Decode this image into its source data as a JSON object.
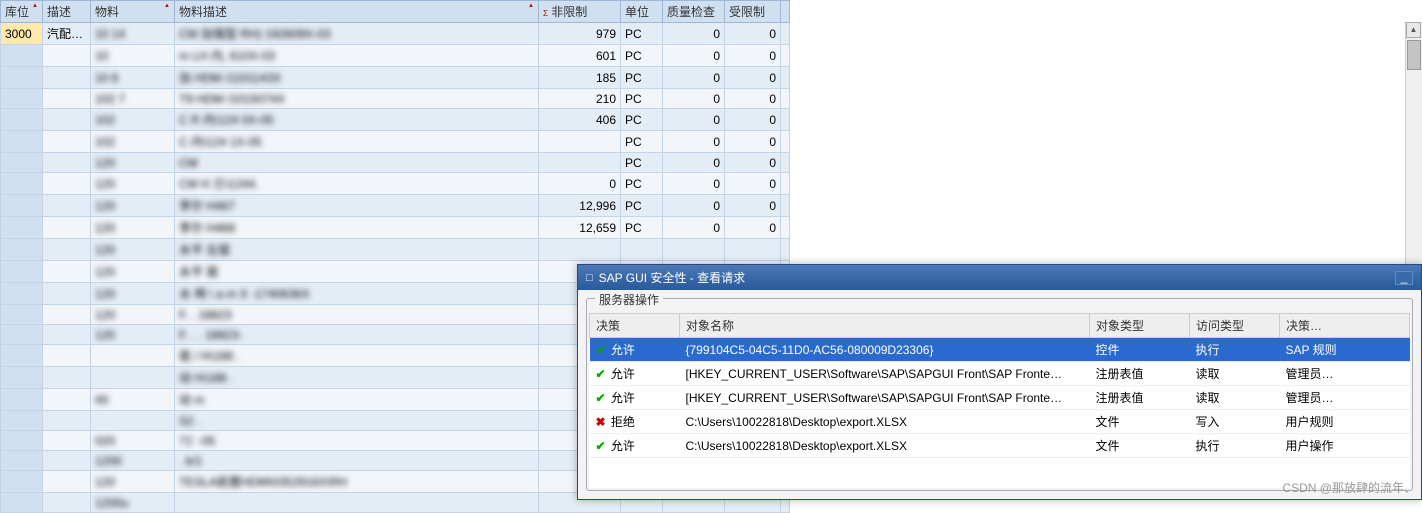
{
  "table": {
    "headers": [
      "库位",
      "描述",
      "物料",
      "物料描述",
      "非限制",
      "单位",
      "质量检查",
      "受限制"
    ],
    "rows": [
      {
        "loc": "3000",
        "des": "汽配…",
        "mat": "10      14",
        "mdesc": "CM    加强型 RH)      192609X-03",
        "unl": "979",
        "uom": "PC",
        "qc": "0",
        "res": "0",
        "sel": true
      },
      {
        "loc": "",
        "des": "",
        "mat": "10",
        "mdesc": "  m   LH    内,    610X-03",
        "unl": "601",
        "uom": "PC",
        "qc": "0",
        "res": "0"
      },
      {
        "loc": "",
        "des": "",
        "mat": "10     6",
        "mdesc": "        加    HDM    /1101143X",
        "unl": "185",
        "uom": "PC",
        "qc": "0",
        "res": "0"
      },
      {
        "loc": "",
        "des": "",
        "mat": "102     7",
        "mdesc": "T9          HDM    /1015074X",
        "unl": "210",
        "uom": "PC",
        "qc": "0",
        "res": "0"
      },
      {
        "loc": "",
        "des": "",
        "mat": "102",
        "mdesc": "C       R    内\\124    0X-05",
        "unl": "406",
        "uom": "PC",
        "qc": "0",
        "res": "0"
      },
      {
        "loc": "",
        "des": "",
        "mat": "102",
        "mdesc": "C            内\\124    1X-05",
        "unl": "",
        "uom": "PC",
        "qc": "0",
        "res": "0"
      },
      {
        "loc": "",
        "des": "",
        "mat": "120",
        "mdesc": "CM",
        "unl": "",
        "uom": "PC",
        "qc": "0",
        "res": "0"
      },
      {
        "loc": "",
        "des": "",
        "mat": "120",
        "mdesc": "CM       H    兰\\1244.",
        "unl": "  0",
        "uom": "PC",
        "qc": "0",
        "res": "0"
      },
      {
        "loc": "",
        "des": "",
        "mat": "120",
        "mdesc": "李尔           H467",
        "unl": "12,996",
        "uom": "PC",
        "qc": "0",
        "res": "0"
      },
      {
        "loc": "",
        "des": "",
        "mat": "120",
        "mdesc": "李尔           H468",
        "unl": "12,659",
        "uom": "PC",
        "qc": "0",
        "res": "0"
      },
      {
        "loc": "",
        "des": "",
        "mat": "120",
        "mdesc": "水平              左驱",
        "unl": "",
        "uom": "",
        "qc": "",
        "res": ""
      },
      {
        "loc": "",
        "des": "",
        "mat": "120",
        "mdesc": "水平              驱",
        "unl": "",
        "uom": "",
        "qc": "",
        "res": ""
      },
      {
        "loc": "",
        "des": "",
        "mat": "120",
        "mdesc": "水  椅     \\ a m   X   -1740636X",
        "unl": "",
        "uom": "",
        "qc": "",
        "res": ""
      },
      {
        "loc": "",
        "des": "",
        "mat": "120",
        "mdesc": "F.   .         18823",
        "unl": "",
        "uom": "",
        "qc": "",
        "res": ""
      },
      {
        "loc": "",
        "des": "",
        "mat": "120",
        "mdesc": "F.   .  .      18823-",
        "unl": "",
        "uom": "",
        "qc": "",
        "res": ""
      },
      {
        "loc": "",
        "des": "",
        "mat": "",
        "mdesc": "           驱 /   H\\188    .",
        "unl": "",
        "uom": "",
        "qc": "",
        "res": ""
      },
      {
        "loc": "",
        "des": "",
        "mat": "",
        "mdesc": "           动            H\\188    .",
        "unl": "",
        "uom": "",
        "qc": "",
        "res": ""
      },
      {
        "loc": "",
        "des": "",
        "mat": "00",
        "mdesc": "    动         m",
        "unl": "",
        "uom": "",
        "qc": "",
        "res": ""
      },
      {
        "loc": "",
        "des": "",
        "mat": "",
        "mdesc": "S2                  .",
        "unl": "",
        "uom": "",
        "qc": "",
        "res": ""
      },
      {
        "loc": "",
        "des": "",
        "mat": "   020",
        "mdesc": "  71'          -05",
        "unl": "",
        "uom": "",
        "qc": "",
        "res": ""
      },
      {
        "loc": "",
        "des": "",
        "mat": "1200",
        "mdesc": "                     .  b/1 ",
        "unl": "",
        "uom": "",
        "qc": "",
        "res": ""
      },
      {
        "loc": "",
        "des": "",
        "mat": "120",
        "mdesc": "TESLA前置HDM\\0352916X\\RH",
        "unl": "",
        "uom": "",
        "qc": "",
        "res": ""
      },
      {
        "loc": "",
        "des": "",
        "mat": "1200u",
        "mdesc": "",
        "unl": "",
        "uom": "",
        "qc": "",
        "res": ""
      }
    ]
  },
  "dialog": {
    "title": "SAP GUI 安全性 - 查看请求",
    "group": "服务器操作",
    "headers": [
      "决策",
      "对象名称",
      "对象类型",
      "访问类型",
      "决策…"
    ],
    "rows": [
      {
        "icon": "chk",
        "dec": "允许",
        "obj": "{799104C5-04C5-11D0-AC56-080009D23306}",
        "type": "控件",
        "access": "执行",
        "src": "SAP 规则",
        "sel": true
      },
      {
        "icon": "chk",
        "dec": "允许",
        "obj": "[HKEY_CURRENT_USER\\Software\\SAP\\SAPGUI Front\\SAP Fronte…",
        "type": "注册表值",
        "access": "读取",
        "src": "管理员…"
      },
      {
        "icon": "chk",
        "dec": "允许",
        "obj": "[HKEY_CURRENT_USER\\Software\\SAP\\SAPGUI Front\\SAP Fronte…",
        "type": "注册表值",
        "access": "读取",
        "src": "管理员…"
      },
      {
        "icon": "cross",
        "dec": "拒绝",
        "obj": "C:\\Users\\10022818\\Desktop\\export.XLSX",
        "type": "文件",
        "access": "写入",
        "src": "用户规则"
      },
      {
        "icon": "chk",
        "dec": "允许",
        "obj": "C:\\Users\\10022818\\Desktop\\export.XLSX",
        "type": "文件",
        "access": "执行",
        "src": "用户操作"
      }
    ]
  },
  "glyph": {
    "checkmark": "✔",
    "cross": "✖",
    "minimize": "_",
    "up": "▲",
    "down": "▼",
    "sortUp": "▲",
    "doc": "📄"
  },
  "watermark": "CSDN @那放肆的流年、"
}
